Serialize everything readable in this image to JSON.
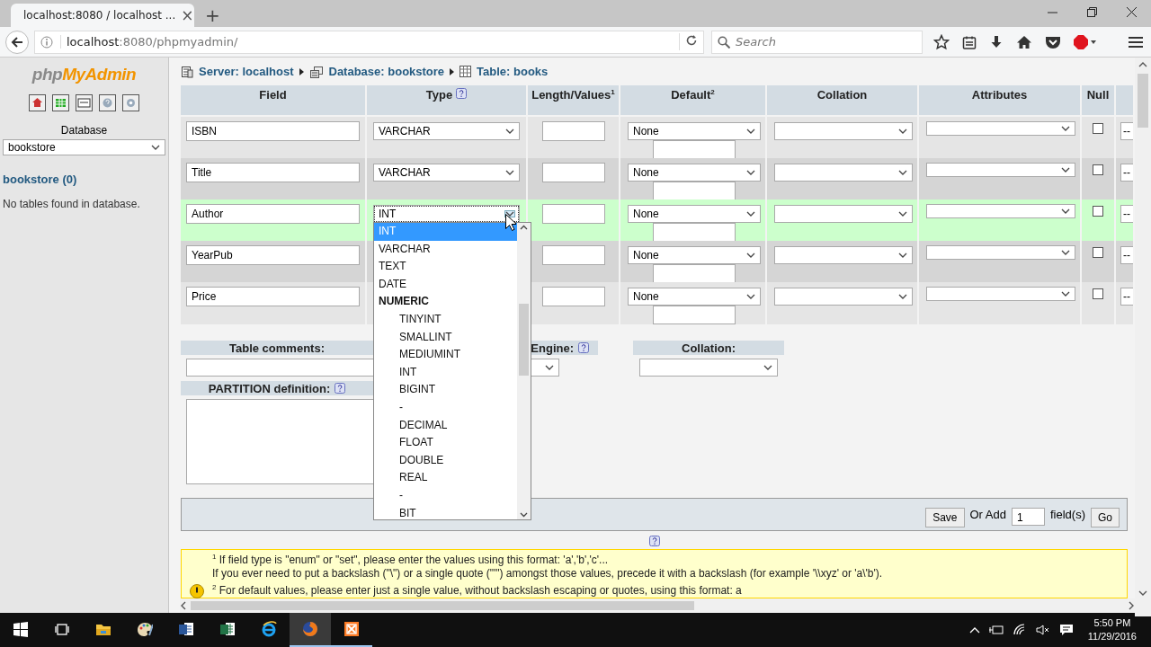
{
  "browser": {
    "tab": {
      "title": "localhost:8080 / localhost ...",
      "close": "×",
      "selected": true
    },
    "new_tab": "+",
    "url": "**localhost**:8080/phpmyadmin/",
    "search": {
      "placeholder": "Search"
    }
  },
  "sidebar": {
    "logo": "php**MyAdmin**",
    "database_label": "Database",
    "database_select": "bookstore",
    "db_link": "bookstore (0)",
    "empty_note": "No tables found in database."
  },
  "breadcrumb": [
    {
      "kind": "server",
      "label": "Server: localhost"
    },
    {
      "kind": "database",
      "label": "Database: bookstore"
    },
    {
      "kind": "table",
      "label": "Table: books"
    }
  ],
  "table": {
    "columns": [
      {
        "label": "Field",
        "help": false
      },
      {
        "label": "Type",
        "help": true
      },
      {
        "label": "Length/Values$^{1}$",
        "help": false
      },
      {
        "label": "Default$^{2}$",
        "help": false
      },
      {
        "label": "Collation",
        "help": false
      },
      {
        "label": "Attributes",
        "help": false
      },
      {
        "label": "Null",
        "help": false
      }
    ],
    "rows": [
      {
        "field": "ISBN",
        "type": "VARCHAR",
        "default": "None",
        "null": false,
        "highlighted": false,
        "column_9": "--"
      },
      {
        "field": "Title",
        "type": "VARCHAR",
        "default": "None",
        "null": false,
        "highlighted": false,
        "column_9": "--"
      },
      {
        "field": "Author",
        "type": "INT",
        "default": "None",
        "null": false,
        "highlighted": true,
        "column_9": "--",
        "type_options": [
          {
            "label": "INT",
            "kind": "option",
            "selected": true
          },
          {
            "label": "VARCHAR",
            "kind": "option",
            "selected": false
          },
          {
            "label": "TEXT",
            "kind": "option",
            "selected": false
          },
          {
            "label": "DATE",
            "kind": "option",
            "selected": false
          },
          {
            "label": "NUMERIC",
            "kind": "group",
            "selected": false
          },
          {
            "label": "TINYINT",
            "kind": "sub",
            "selected": false
          },
          {
            "label": "SMALLINT",
            "kind": "sub",
            "selected": false
          },
          {
            "label": "MEDIUMINT",
            "kind": "sub",
            "selected": false
          },
          {
            "label": "INT",
            "kind": "sub",
            "selected": false
          },
          {
            "label": "BIGINT",
            "kind": "sub",
            "selected": false
          },
          {
            "label": "-",
            "kind": "sub",
            "selected": false
          },
          {
            "label": "DECIMAL",
            "kind": "sub",
            "selected": false
          },
          {
            "label": "FLOAT",
            "kind": "sub",
            "selected": false
          },
          {
            "label": "DOUBLE",
            "kind": "sub",
            "selected": false
          },
          {
            "label": "REAL",
            "kind": "sub",
            "selected": false
          },
          {
            "label": "-",
            "kind": "sub",
            "selected": false
          },
          {
            "label": "BIT",
            "kind": "sub",
            "selected": false
          }
        ]
      },
      {
        "field": "YearPub",
        "default": "None",
        "null": false,
        "highlighted": false,
        "column_9": "--"
      },
      {
        "field": "Price",
        "default": "None",
        "null": false,
        "highlighted": false,
        "column_9": "--"
      }
    ]
  },
  "table_options": {
    "comments_label": "Table comments:",
    "engine_label": "Engine:",
    "collation_label": "Collation:",
    "partition_label": "PARTITION definition:"
  },
  "footer_bar": {
    "save": "Save",
    "or_add": "Or Add",
    "count": "1",
    "fields": "field(s)",
    "go": "Go"
  },
  "notes": [
    "$^{1}$ If field type is \"enum\" or \"set\", please enter the values using this format: 'a','b','c'...",
    "If you ever need to put a backslash (\"\\\") or a single quote (\"'\") amongst those values, precede it with a backslash (for example '\\\\xyz' or 'a\\'b').",
    "$^{2}$ For default values, please enter just a single value, without backslash escaping or quotes, using this format: a"
  ],
  "taskbar": {
    "apps": [
      {
        "kind": "start",
        "active": false,
        "running": false
      },
      {
        "kind": "taskview",
        "active": false,
        "running": false
      },
      {
        "kind": "explorer",
        "active": false,
        "running": false
      },
      {
        "kind": "paint",
        "active": false,
        "running": false
      },
      {
        "kind": "word",
        "active": false,
        "running": false
      },
      {
        "kind": "excel",
        "active": false,
        "running": false
      },
      {
        "kind": "ie",
        "active": false,
        "running": false
      },
      {
        "kind": "firefox",
        "active": true,
        "running": true
      },
      {
        "kind": "xampp",
        "active": false,
        "running": true
      }
    ],
    "time": "5:50 PM",
    "date": "11/29/2016"
  }
}
